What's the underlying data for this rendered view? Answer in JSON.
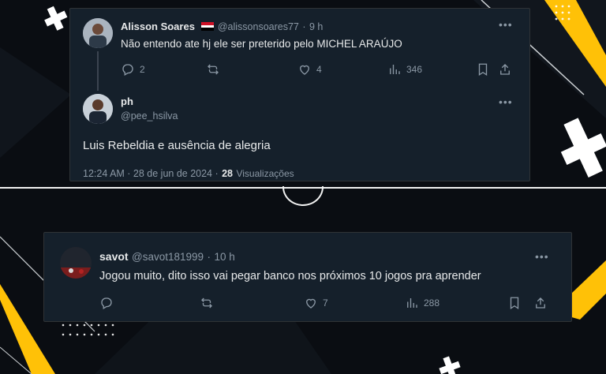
{
  "colors": {
    "accent_yellow": "#ffc107",
    "card_bg": "#15202b",
    "muted": "#8b98a5"
  },
  "reply_tweet": {
    "author_name": "Alisson Soares",
    "author_handle": "@alissonsoares77",
    "separator": "·",
    "time": "9 h",
    "text": "Não entendo ate hj ele ser preterido pelo MICHEL ARAÚJO",
    "replies": "2",
    "likes": "4",
    "views": "346"
  },
  "main_tweet": {
    "author_name": "ph",
    "author_handle": "@pee_hsilva",
    "text": "Luis Rebeldia e ausência de alegria",
    "timestamp": "12:24 AM · 28 de jun de 2024 ·",
    "views_count": "28",
    "views_label": "Visualizações"
  },
  "bottom_tweet": {
    "author_name": "savot",
    "author_handle": "@savot181999",
    "separator": "·",
    "time": "10 h",
    "text": "Jogou muito, dito isso vai pegar banco nos próximos 10 jogos pra aprender",
    "likes": "7",
    "views": "288"
  },
  "icons": [
    "reply-icon",
    "retweet-icon",
    "like-icon",
    "views-icon",
    "bookmark-icon",
    "share-icon",
    "more-icon"
  ]
}
